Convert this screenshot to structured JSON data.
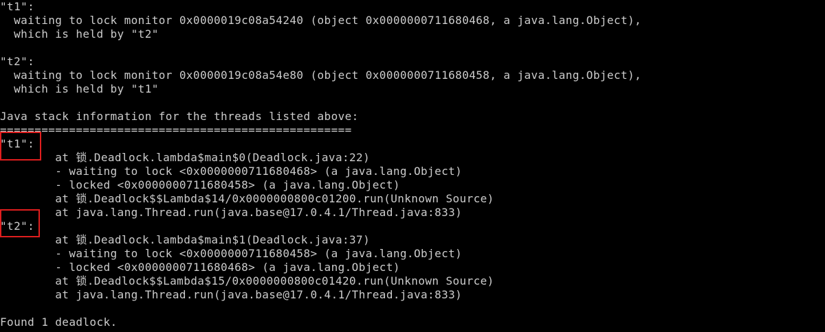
{
  "terminal": {
    "colors": {
      "background": "#000000",
      "text": "#cccccc",
      "highlight_border": "#e01e1e"
    },
    "lines": [
      "\"t1\":",
      "  waiting to lock monitor 0x0000019c08a54240 (object 0x0000000711680468, a java.lang.Object),",
      "  which is held by \"t2\"",
      "\"t2\":",
      "  waiting to lock monitor 0x0000019c08a54e80 (object 0x0000000711680458, a java.lang.Object),",
      "  which is held by \"t1\"",
      "Java stack information for the threads listed above:",
      "===================================================",
      "\"t1\":",
      "        at 锁.Deadlock.lambda$main$0(Deadlock.java:22)",
      "        - waiting to lock <0x0000000711680468> (a java.lang.Object)",
      "        - locked <0x0000000711680458> (a java.lang.Object)",
      "        at 锁.Deadlock$$Lambda$14/0x0000000800c01200.run(Unknown Source)",
      "        at java.lang.Thread.run(java.base@17.0.4.1/Thread.java:833)",
      "\"t2\":",
      "        at 锁.Deadlock.lambda$main$1(Deadlock.java:37)",
      "        - waiting to lock <0x0000000711680458> (a java.lang.Object)",
      "        - locked <0x0000000711680468> (a java.lang.Object)",
      "        at 锁.Deadlock$$Lambda$15/0x0000000800c01420.run(Unknown Source)",
      "        at java.lang.Thread.run(java.base@17.0.4.1/Thread.java:833)",
      "Found 1 deadlock."
    ]
  }
}
